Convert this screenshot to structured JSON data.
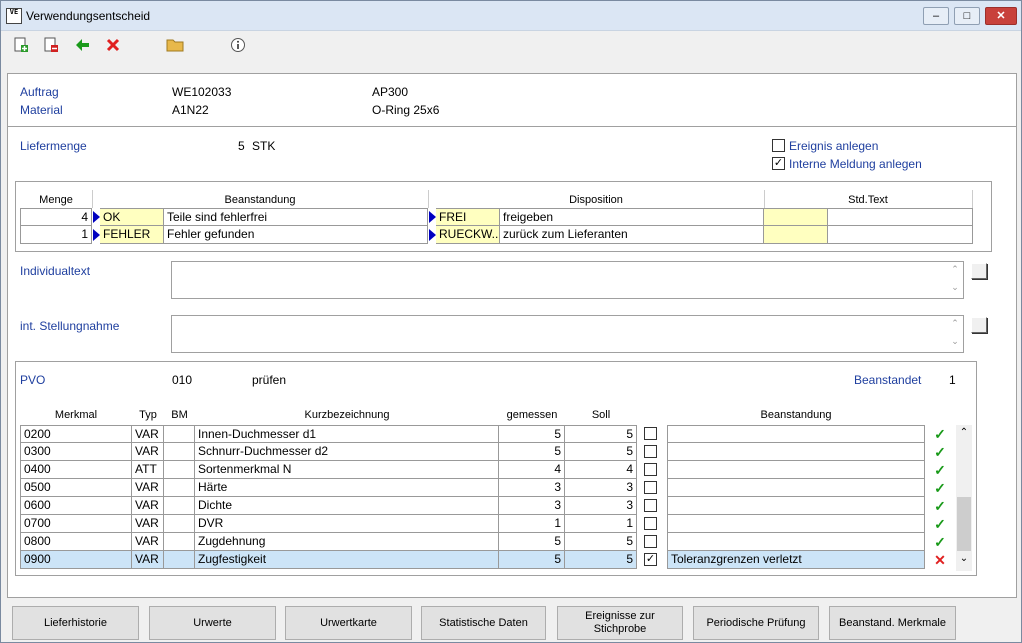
{
  "window": {
    "title": "Verwendungsentscheid",
    "icon_text": "VE",
    "minimize": "–",
    "maximize": "□",
    "close": "✕"
  },
  "toolbar": {
    "icons": [
      "new-doc-icon",
      "delete-doc-icon",
      "back-arrow-icon",
      "cancel-x-icon",
      "folder-icon",
      "info-icon"
    ]
  },
  "header": {
    "auftrag_label": "Auftrag",
    "auftrag_value": "WE102033",
    "auftrag_extra": "AP300",
    "material_label": "Material",
    "material_value": "A1N22",
    "material_extra": "O-Ring 25x6"
  },
  "liefer": {
    "label": "Liefermenge",
    "qty": "5",
    "unit": "STK"
  },
  "options": {
    "ereignis_label": "Ereignis anlegen",
    "ereignis_checked": "",
    "meldung_label": "Interne Meldung anlegen",
    "meldung_checked": "✓"
  },
  "grid1": {
    "headers": {
      "menge": "Menge",
      "beanstandung": "Beanstandung",
      "disposition": "Disposition",
      "stdtext": "Std.Text"
    },
    "rows": [
      {
        "menge": "4",
        "code": "OK",
        "text": "Teile sind fehlerfrei",
        "dcode": "FREI",
        "dtext": "freigeben",
        "std": "",
        "std2": ""
      },
      {
        "menge": "1",
        "code": "FEHLER",
        "text": "Fehler gefunden",
        "dcode": "RUECKW...",
        "dtext": "zurück zum Lieferanten",
        "std": "",
        "std2": ""
      }
    ]
  },
  "texts": {
    "individual_label": "Individualtext",
    "stellung_label": "int. Stellungnahme"
  },
  "pvo": {
    "label": "PVO",
    "code": "010",
    "text": "prüfen",
    "beanstandet_label": "Beanstandet",
    "beanstandet_value": "1"
  },
  "grid2": {
    "headers": {
      "merkmal": "Merkmal",
      "typ": "Typ",
      "bm": "BM",
      "kurz": "Kurzbezeichnung",
      "gemessen": "gemessen",
      "soll": "Soll",
      "beanstandung": "Beanstandung"
    },
    "rows": [
      {
        "merkmal": "0200",
        "typ": "VAR",
        "bm": "",
        "kurz": "Innen-Duchmesser d1",
        "gemessen": "5",
        "soll": "5",
        "check": "",
        "beanstandung": "",
        "status": "✓"
      },
      {
        "merkmal": "0300",
        "typ": "VAR",
        "bm": "",
        "kurz": "Schnurr-Duchmesser d2",
        "gemessen": "5",
        "soll": "5",
        "check": "",
        "beanstandung": "",
        "status": "✓"
      },
      {
        "merkmal": "0400",
        "typ": "ATT",
        "bm": "",
        "kurz": "Sortenmerkmal N",
        "gemessen": "4",
        "soll": "4",
        "check": "",
        "beanstandung": "",
        "status": "✓"
      },
      {
        "merkmal": "0500",
        "typ": "VAR",
        "bm": "",
        "kurz": "Härte",
        "gemessen": "3",
        "soll": "3",
        "check": "",
        "beanstandung": "",
        "status": "✓"
      },
      {
        "merkmal": "0600",
        "typ": "VAR",
        "bm": "",
        "kurz": "Dichte",
        "gemessen": "3",
        "soll": "3",
        "check": "",
        "beanstandung": "",
        "status": "✓"
      },
      {
        "merkmal": "0700",
        "typ": "VAR",
        "bm": "",
        "kurz": "DVR",
        "gemessen": "1",
        "soll": "1",
        "check": "",
        "beanstandung": "",
        "status": "✓"
      },
      {
        "merkmal": "0800",
        "typ": "VAR",
        "bm": "",
        "kurz": "Zugdehnung",
        "gemessen": "5",
        "soll": "5",
        "check": "",
        "beanstandung": "",
        "status": "✓"
      },
      {
        "merkmal": "0900",
        "typ": "VAR",
        "bm": "",
        "kurz": "Zugfestigkeit",
        "gemessen": "5",
        "soll": "5",
        "check": "✓",
        "beanstandung": "Toleranzgrenzen verletzt",
        "status": "✕"
      }
    ]
  },
  "buttons": [
    "Lieferhistorie",
    "Urwerte",
    "Urwertkarte",
    "Statistische Daten",
    "Ereignisse zur Stichprobe",
    "Periodische Prüfung",
    "Beanstand. Merkmale"
  ],
  "colors": {
    "label_blue": "#1f3f9f",
    "selected_row": "#cce4f7",
    "ok_green": "#1a9a1a",
    "error_red": "#e02020",
    "highlight_yellow": "#ffffc0"
  }
}
